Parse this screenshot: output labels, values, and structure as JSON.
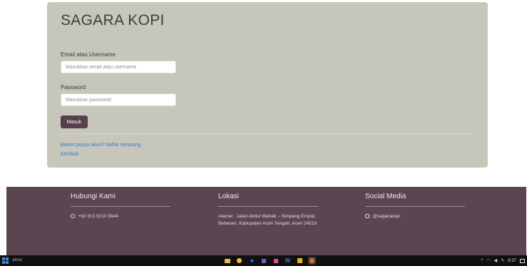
{
  "card": {
    "brand": "SAGARA KOPI",
    "email_label": "Email atau Username",
    "email_placeholder": "Masukkan email atau username",
    "password_label": "Password",
    "password_placeholder": "Masukkan password",
    "submit_label": "Masuk",
    "register_link": "Belum punya akun? daftar sekarang",
    "back_link": "Kembali"
  },
  "footer": {
    "contact": {
      "title": "Hubungi Kami",
      "icon": "whatsapp-icon",
      "text": ": +62 813 6210 5644"
    },
    "location": {
      "title": "Lokasi",
      "text": "Alamat : Jalan Abdul Wahab – Simpang Empat, Bebesen, Kabupaten Aceh Tengah, Aceh 24519"
    },
    "social": {
      "title": "Social Media",
      "icon": "instagram-icon",
      "text": ": @sagarakopi"
    }
  },
  "taskbar": {
    "search": "abrar",
    "clock": "8:37"
  },
  "colors": {
    "card_bg": "#c7c6bb",
    "accent": "#56404b",
    "footer_bg": "#5b4550",
    "link": "#3a7bd5",
    "taskbar_bg": "#101010"
  }
}
